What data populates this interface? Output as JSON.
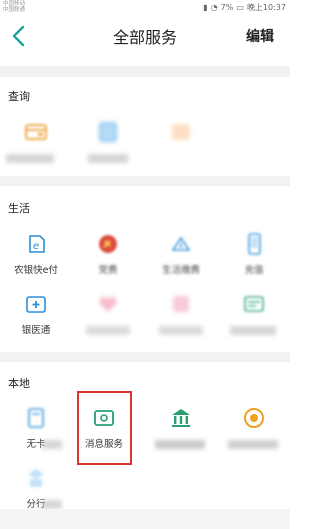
{
  "status_bar": {
    "carrier_line1": "中国移动",
    "carrier_line2": "中国联通",
    "battery": "7%",
    "time": "晚上10:37"
  },
  "nav": {
    "title": "全部服务",
    "edit_label": "编辑"
  },
  "sections": {
    "query": {
      "title": "查询",
      "items": [
        {
          "label": "",
          "icon": "card-icon",
          "color": "#f0a030"
        },
        {
          "label": "",
          "icon": "document-icon",
          "color": "#4aa0e0"
        },
        {
          "label": "",
          "icon": "box-icon",
          "color": "#f0b080"
        }
      ]
    },
    "life": {
      "title": "生活",
      "items": [
        {
          "label": "农银快e付",
          "icon": "e-pay-icon",
          "color": "#2a8fd8"
        },
        {
          "label": "党费",
          "icon": "party-icon",
          "color": "#d83a2a"
        },
        {
          "label": "生活缴费",
          "icon": "house-icon",
          "color": "#2a8fd8"
        },
        {
          "label": "充值",
          "icon": "phone-icon",
          "color": "#2a8fd8"
        },
        {
          "label": "银医通",
          "icon": "hospital-icon",
          "color": "#2a8fd8"
        },
        {
          "label": "",
          "icon": "heart-icon",
          "color": "#e06080"
        },
        {
          "label": "",
          "icon": "gift-icon",
          "color": "#e06080"
        },
        {
          "label": "",
          "icon": "card2-icon",
          "color": "#2aa080"
        }
      ]
    },
    "local": {
      "title": "本地",
      "items": [
        {
          "label": "无卡",
          "icon": "nocard-icon",
          "color": "#2a8fd8"
        },
        {
          "label": "消息服务",
          "icon": "message-icon",
          "color": "#2aa070"
        },
        {
          "label": "",
          "icon": "bank-icon",
          "color": "#2aa070"
        },
        {
          "label": "",
          "icon": "coin-icon",
          "color": "#f0a020"
        },
        {
          "label": "分行",
          "icon": "branch-icon",
          "color": "#2a8fd8"
        }
      ]
    }
  }
}
